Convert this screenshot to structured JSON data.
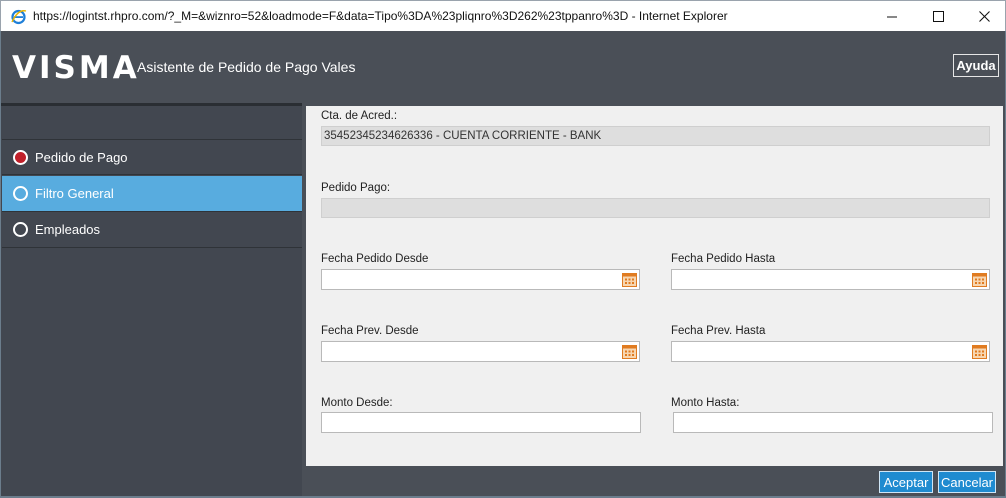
{
  "window": {
    "title": "https://logintst.rhpro.com/?_M=&wiznro=52&loadmode=F&data=Tipo%3DA%23pliqnro%3D262%23tppanro%3D - Internet Explorer"
  },
  "header": {
    "logo": "VISMA",
    "title": "Asistente de Pedido de Pago Vales",
    "help_label": "Ayuda"
  },
  "sidebar": {
    "items": [
      {
        "label": "Pedido de Pago",
        "state": "done"
      },
      {
        "label": "Filtro General",
        "state": "active"
      },
      {
        "label": "Empleados",
        "state": "pending"
      }
    ]
  },
  "form": {
    "cta_label": "Cta. de Acred.:",
    "cta_value": "35452345234626336 - CUENTA CORRIENTE - BANK",
    "pedido_label": "Pedido Pago:",
    "pedido_value": "",
    "fecha_pedido_desde_label": "Fecha Pedido Desde",
    "fecha_pedido_desde_value": "",
    "fecha_pedido_hasta_label": "Fecha Pedido Hasta",
    "fecha_pedido_hasta_value": "",
    "fecha_prev_desde_label": "Fecha Prev. Desde",
    "fecha_prev_desde_value": "",
    "fecha_prev_hasta_label": "Fecha Prev. Hasta",
    "fecha_prev_hasta_value": "",
    "monto_desde_label": "Monto Desde:",
    "monto_desde_value": "",
    "monto_hasta_label": "Monto Hasta:",
    "monto_hasta_value": ""
  },
  "footer": {
    "accept_label": "Aceptar",
    "cancel_label": "Cancelar"
  },
  "colors": {
    "header_bg": "#4a4f57",
    "sidebar_active": "#58acdf",
    "button_blue": "#1f8bd0",
    "radio_done": "#c0202a",
    "calendar_orange": "#e07b20"
  },
  "icons": {
    "browser": "internet-explorer-icon",
    "calendar": "calendar-icon",
    "minimize": "minimize-icon",
    "maximize": "maximize-icon",
    "close": "close-icon"
  }
}
